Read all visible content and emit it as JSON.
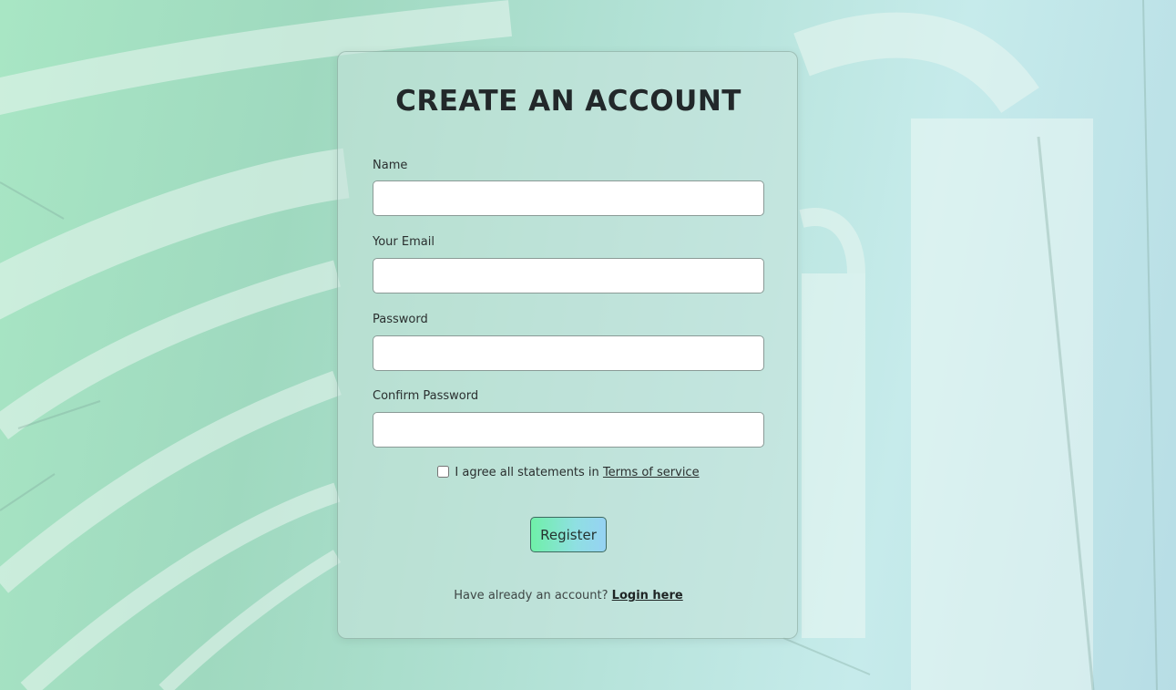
{
  "form": {
    "title": "CREATE AN ACCOUNT",
    "fields": [
      {
        "label": "Name",
        "value": "",
        "placeholder": ""
      },
      {
        "label": "Your Email",
        "value": "",
        "placeholder": ""
      },
      {
        "label": "Password",
        "value": "",
        "placeholder": ""
      },
      {
        "label": "Confirm Password",
        "value": "",
        "placeholder": ""
      }
    ],
    "terms": {
      "text": "I agree all statements in",
      "link": "Terms of service",
      "checked": false
    },
    "register_label": "Register",
    "login": {
      "text": "Have already an account?",
      "link": "Login here"
    }
  },
  "colors": {
    "button_gradient_start": "#6ff0a8",
    "button_gradient_end": "#96d2f3",
    "title": "#22282a"
  }
}
